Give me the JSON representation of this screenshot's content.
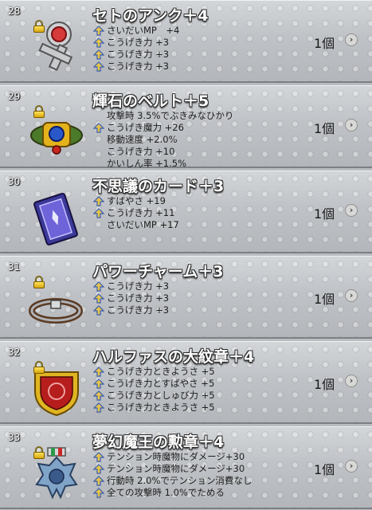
{
  "items": [
    {
      "number": "28",
      "name": "セトのアンク＋4",
      "quantity": "1個",
      "icon": "ankh-icon",
      "effects": [
        {
          "text": "さいだいMP　+4",
          "badge": true
        },
        {
          "text": "こうげき力 +3",
          "badge": true
        },
        {
          "text": "こうげき力 +3",
          "badge": true
        },
        {
          "text": "こうげき力 +3",
          "badge": true
        }
      ]
    },
    {
      "number": "29",
      "name": "輝石のベルト＋5",
      "quantity": "1個",
      "icon": "belt-icon",
      "effects": [
        {
          "text": "攻撃時 3.5%でぶきみなひかり",
          "badge": false
        },
        {
          "text": "こうげき魔力 +26",
          "badge": true
        },
        {
          "text": "移動速度 +2.0%",
          "badge": false
        },
        {
          "text": "こうげき力 +10",
          "badge": false
        },
        {
          "text": "かいしん率 +1.5%",
          "badge": false
        }
      ]
    },
    {
      "number": "30",
      "name": "不思議のカード＋3",
      "quantity": "1個",
      "icon": "card-icon",
      "effects": [
        {
          "text": "すばやさ +19",
          "badge": true
        },
        {
          "text": "こうげき力 +11",
          "badge": true
        },
        {
          "text": "さいだいMP +17",
          "badge": false
        }
      ]
    },
    {
      "number": "31",
      "name": "パワーチャーム＋3",
      "quantity": "1個",
      "icon": "bracelet-icon",
      "effects": [
        {
          "text": "こうげき力 +3",
          "badge": true
        },
        {
          "text": "こうげき力 +3",
          "badge": true
        },
        {
          "text": "こうげき力 +3",
          "badge": true
        }
      ]
    },
    {
      "number": "32",
      "name": "ハルファスの大紋章＋4",
      "quantity": "1個",
      "icon": "crest-icon",
      "effects": [
        {
          "text": "こうげき力ときようさ +5",
          "badge": true
        },
        {
          "text": "こうげき力とすばやさ +5",
          "badge": true
        },
        {
          "text": "こうげき力としゅび力 +5",
          "badge": true
        },
        {
          "text": "こうげき力ときようさ +5",
          "badge": true
        }
      ]
    },
    {
      "number": "33",
      "name": "夢幻魔王の勲章＋4",
      "quantity": "1個",
      "icon": "medal-icon",
      "effects": [
        {
          "text": "テンション時魔物にダメージ+30",
          "badge": true
        },
        {
          "text": "テンション時魔物にダメージ+30",
          "badge": true
        },
        {
          "text": "行動時 2.0%でテンション消費なし",
          "badge": true
        },
        {
          "text": "全ての攻撃時 1.0%でためる",
          "badge": true
        }
      ]
    }
  ],
  "arrow_glyph": "›"
}
